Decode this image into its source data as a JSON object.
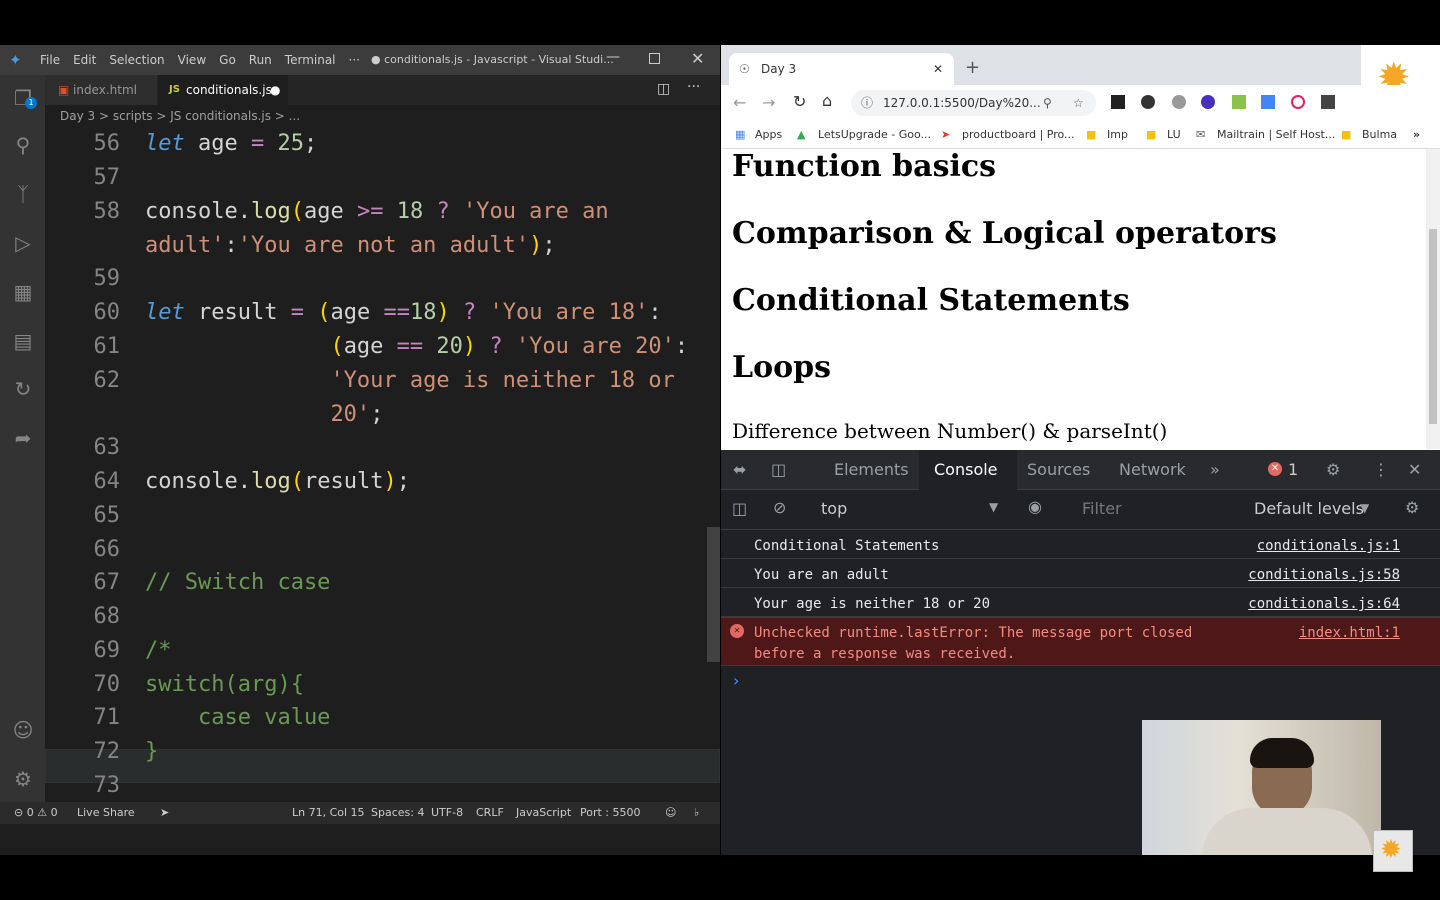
{
  "vscode": {
    "menu": [
      "File",
      "Edit",
      "Selection",
      "View",
      "Go",
      "Run",
      "Terminal",
      "···"
    ],
    "window_title": "● conditionals.js - Javascript - Visual Studi...",
    "tabs": [
      {
        "label": "index.html"
      },
      {
        "label": "conditionals.js"
      }
    ],
    "breadcrumb": "Day 3 > scripts > JS conditionals.js > ...",
    "line_numbers": [
      "56",
      "57",
      "58",
      "59",
      "60",
      "61",
      "62",
      "63",
      "64",
      "65",
      "66",
      "67",
      "68",
      "69",
      "70",
      "71",
      "72",
      "73"
    ],
    "status": {
      "problems": "⊝ 0 ⚠ 0",
      "live_share": "Live Share",
      "position": "Ln 71, Col 15",
      "spaces": "Spaces: 4",
      "encoding": "UTF-8",
      "eol": "CRLF",
      "language": "JavaScript",
      "port": "Port : 5500"
    }
  },
  "browser": {
    "tab_title": "Day 3",
    "url": "127.0.0.1:5500/Day%20...",
    "bookmarks": [
      "Apps",
      "LetsUpgrade - Goo...",
      "productboard | Pro...",
      "Imp",
      "LU",
      "Mailtrain | Self Host...",
      "Bulma"
    ],
    "headings": [
      "Function basics",
      "Comparison & Logical operators",
      "Conditional Statements",
      "Loops"
    ],
    "paragraph": "Difference between Number() & parseInt()",
    "devtools": {
      "tabs": [
        "Elements",
        "Console",
        "Sources",
        "Network"
      ],
      "error_count": "1",
      "context": "top",
      "filter_placeholder": "Filter",
      "levels": "Default levels",
      "messages": [
        {
          "text": "Conditional Statements",
          "source": "conditionals.js:1"
        },
        {
          "text": "You are an adult",
          "source": "conditionals.js:58"
        },
        {
          "text": "Your age is neither 18 or 20",
          "source": "conditionals.js:64"
        }
      ],
      "error": {
        "line1": "Unchecked runtime.lastError: The message port closed",
        "line2": "before a response was received.",
        "source": "index.html:1"
      }
    }
  },
  "colors": {
    "accent": "#007acc",
    "error_bg": "#4e1818",
    "vscode_bg": "#1e1e1e"
  }
}
